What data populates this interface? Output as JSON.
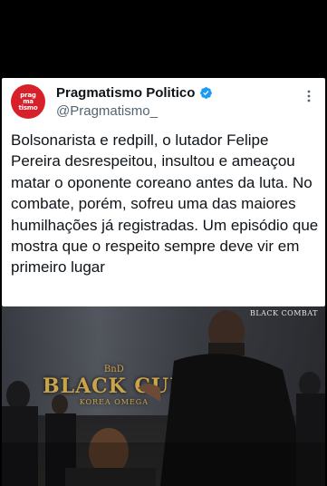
{
  "tweet": {
    "display_name": "Pragmatismo Politico",
    "handle": "@Pragmatismo_",
    "avatar_text": [
      "prag",
      "ma",
      "tismo"
    ],
    "text": "Bolsonarista e redpill, o lutador Felipe Pereira desrespeitou, insultou e ameaçou matar o oponente coreano antes da luta. No combate, porém, sofreu uma das maiores humilhações já registradas. Um episódio que mostra que o respeito sempre deve vir em primeiro lugar"
  },
  "video": {
    "watermark_line1": "BLACK COMBAT",
    "watermark_line2": "",
    "event_small": "BnD",
    "event_big": "BLACK CUP",
    "event_sub": "KOREA OMEGA"
  },
  "colors": {
    "verified": "#1d9bf0",
    "avatar_bg": "#d8202b"
  }
}
